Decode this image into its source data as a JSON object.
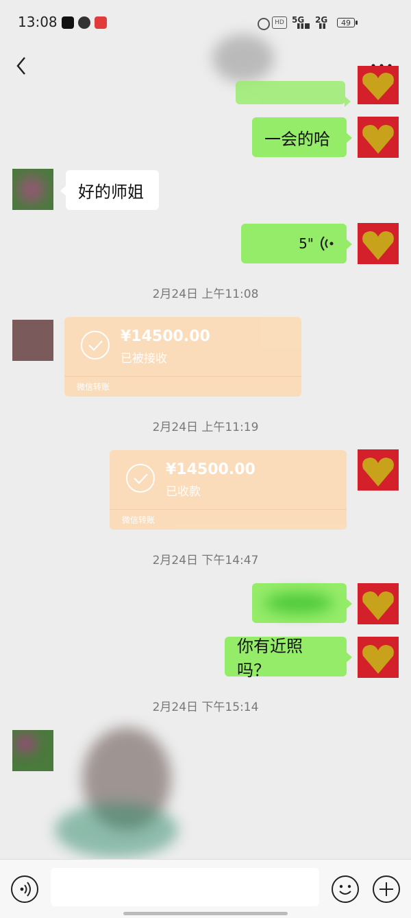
{
  "status": {
    "time": "13:08",
    "signal_a": "5G",
    "signal_b": "2G",
    "battery": "49"
  },
  "colors": {
    "my_bubble": "#95ec69",
    "their_bubble": "#ffffff",
    "transfer_card": "#fbdcb8",
    "background": "#ededed"
  },
  "messages": {
    "m1": "一会的哈",
    "m2": "好的师姐",
    "voice_duration": "5\"",
    "ts1": "2月24日 上午11:08",
    "transfer1": {
      "amount": "¥14500.00",
      "status": "已被接收",
      "brand": "微信转账"
    },
    "ts2": "2月24日 上午11:19",
    "transfer2": {
      "amount": "¥14500.00",
      "status": "已收款",
      "brand": "微信转账"
    },
    "ts3": "2月24日 下午14:47",
    "m3": "你有近照吗？",
    "ts4": "2月24日 下午15:14"
  }
}
